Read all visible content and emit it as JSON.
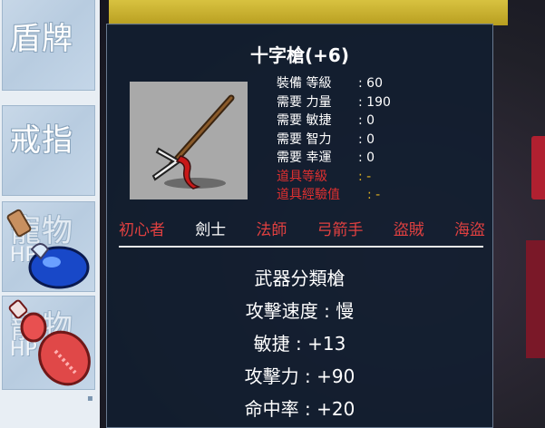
{
  "sidebar": {
    "items": [
      {
        "label": "盾牌"
      },
      {
        "label": "戒指"
      },
      {
        "label": "寵物",
        "sub": "HP"
      },
      {
        "label": "寵物",
        "sub": "HP"
      }
    ]
  },
  "item": {
    "name": "十字槍(+6)",
    "icon": "cross-spear-icon",
    "stats": [
      {
        "label": "裝備 等級",
        "value": ": 60"
      },
      {
        "label": "需要 力量",
        "value": ": 190"
      },
      {
        "label": "需要 敏捷",
        "value": ": 0"
      },
      {
        "label": "需要 智力",
        "value": ": 0"
      },
      {
        "label": "需要 幸運",
        "value": ": 0"
      },
      {
        "label": "道具等級",
        "value": ": -"
      },
      {
        "label": "道具經驗值",
        "value": ": -"
      }
    ],
    "jobs": [
      "初心者",
      "劍士",
      "法師",
      "弓箭手",
      "盜賊",
      "海盜"
    ],
    "properties": [
      "武器分類槍",
      "攻擊速度 : 慢",
      "敏捷 : +13",
      "攻擊力 : +90",
      "命中率 : +20"
    ]
  },
  "colors": {
    "allowed_job": "#ffffff",
    "disallowed_job": "#e04040",
    "tooltip_bg": "#121e30"
  }
}
